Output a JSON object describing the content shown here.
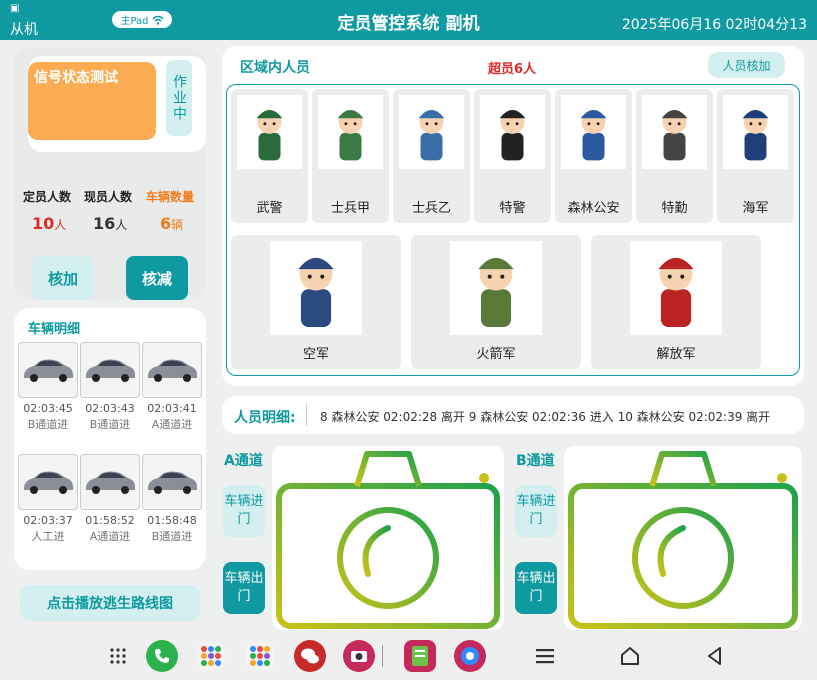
{
  "header": {
    "mode_icon": "sim-card-icon",
    "mode": "从机",
    "pad_label": "主Pad",
    "title": "定员管控系统 副机",
    "datetime": "2025年06月16 02时04分13"
  },
  "signal": {
    "title": "信号状态测试",
    "state": "作业中"
  },
  "stats": {
    "quota_label": "定员人数",
    "current_label": "现员人数",
    "vehicles_label": "车辆数量",
    "quota_value": "10",
    "current_value": "16",
    "vehicles_value": "6",
    "person_unit": "人",
    "vehicle_unit": "辆"
  },
  "buttons": {
    "add": "核加",
    "subtract": "核减",
    "escape": "点击播放逃生路线图"
  },
  "vehicles": {
    "title": "车辆明细",
    "items": [
      {
        "time": "02:03:45",
        "lane": "B通道进"
      },
      {
        "time": "02:03:43",
        "lane": "B通道进"
      },
      {
        "time": "02:03:41",
        "lane": "A通道进"
      },
      {
        "time": "02:03:37",
        "lane": "人工进"
      },
      {
        "time": "01:58:52",
        "lane": "A通道进"
      },
      {
        "time": "01:58:48",
        "lane": "B通道进"
      }
    ]
  },
  "area": {
    "title": "区域内人员",
    "over_label": "超员6人",
    "verify_button": "人员核加",
    "persons": [
      {
        "label": "武警",
        "icon": "armed-police-avatar"
      },
      {
        "label": "士兵甲",
        "icon": "soldier-a-avatar"
      },
      {
        "label": "士兵乙",
        "icon": "soldier-b-avatar"
      },
      {
        "label": "特警",
        "icon": "swat-avatar"
      },
      {
        "label": "森林公安",
        "icon": "forest-police-avatar"
      },
      {
        "label": "特勤",
        "icon": "special-duty-avatar"
      },
      {
        "label": "海军",
        "icon": "navy-avatar"
      },
      {
        "label": "空军",
        "icon": "airforce-avatar"
      },
      {
        "label": "火箭军",
        "icon": "rocket-force-avatar"
      },
      {
        "label": "解放军",
        "icon": "pla-avatar"
      }
    ]
  },
  "detail": {
    "label": "人员明细:",
    "text": "8 森林公安 02:02:28 离开  9 森林公安 02:02:36 进入  10 森林公安 02:02:39 离开"
  },
  "channels": {
    "a_title": "A通道",
    "b_title": "B通道",
    "enter_label": "车辆进门",
    "exit_label": "车辆出门"
  },
  "colors": {
    "primary": "#0e9aa0",
    "light": "#d4eff0",
    "orange": "#fbac52",
    "red": "#e02a2a",
    "orange_text": "#f07d1a"
  },
  "navbar": {
    "items": [
      "apps-grid-icon",
      "phone-icon",
      "app-folder-icon",
      "app-folder-icon",
      "wechat-icon",
      "camera-app-icon",
      "notes-app-icon",
      "settings-icon",
      "menu-icon",
      "home-icon",
      "back-icon"
    ]
  }
}
